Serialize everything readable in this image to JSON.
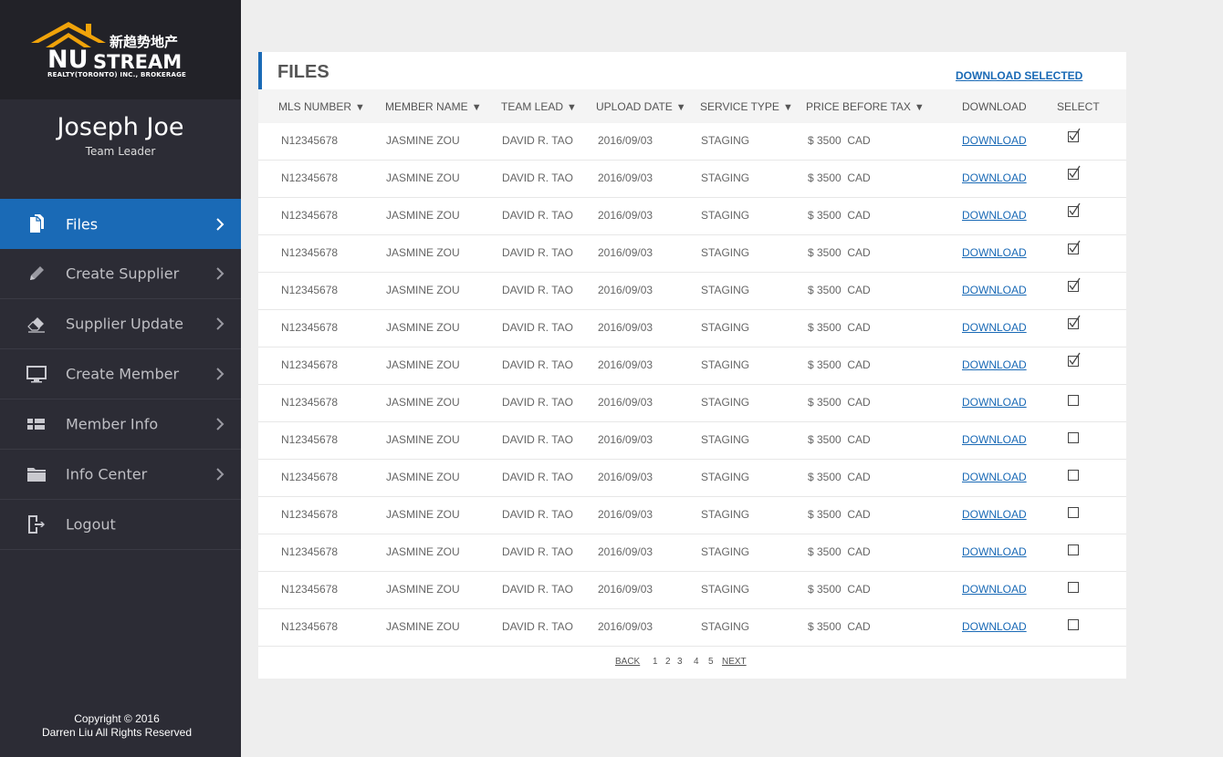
{
  "brand": {
    "logo_main": "NU",
    "logo_stream": "STREAM",
    "logo_cn": "新趋势地产",
    "logo_sub": "REALTY(TORONTO) INC., BROKERAGE",
    "roof_color": "#f0a30a"
  },
  "user": {
    "name": "Joseph Joe",
    "role": "Team Leader"
  },
  "sidebar": {
    "items": [
      {
        "label": "Files",
        "icon": "files-icon",
        "active": true,
        "chevron": true
      },
      {
        "label": "Create Supplier",
        "icon": "pencil-icon",
        "active": false,
        "chevron": true
      },
      {
        "label": "Supplier Update",
        "icon": "eraser-icon",
        "active": false,
        "chevron": true
      },
      {
        "label": "Create Member",
        "icon": "monitor-icon",
        "active": false,
        "chevron": true
      },
      {
        "label": "Member Info",
        "icon": "grid-icon",
        "active": false,
        "chevron": true
      },
      {
        "label": "Info Center",
        "icon": "folder-icon",
        "active": false,
        "chevron": true
      },
      {
        "label": "Logout",
        "icon": "logout-icon",
        "active": false,
        "chevron": false
      }
    ],
    "copyright_line1": "Copyright © 2016",
    "copyright_line2": "Darren Liu All Rights Reserved"
  },
  "files": {
    "title": "FILES",
    "download_selected": "DOWNLOAD SELECTED",
    "columns": [
      {
        "label": "MLS NUMBER",
        "sortable": true
      },
      {
        "label": "MEMBER NAME",
        "sortable": true
      },
      {
        "label": "TEAM LEAD",
        "sortable": true
      },
      {
        "label": "UPLOAD DATE",
        "sortable": true
      },
      {
        "label": "SERVICE TYPE",
        "sortable": true
      },
      {
        "label": "PRICE BEFORE TAX",
        "sortable": true
      },
      {
        "label": "DOWNLOAD",
        "sortable": false
      },
      {
        "label": "SELECT",
        "sortable": false
      }
    ],
    "sort_arrow": "▼",
    "rows": [
      {
        "mls": "N12345678",
        "member": "JASMINE ZOU",
        "lead": "DAVID R. TAO",
        "date": "2016/09/03",
        "service": "STAGING",
        "price": "$ 3500  CAD",
        "download": "DOWNLOAD",
        "selected": true
      },
      {
        "mls": "N12345678",
        "member": "JASMINE ZOU",
        "lead": "DAVID R. TAO",
        "date": "2016/09/03",
        "service": "STAGING",
        "price": "$ 3500  CAD",
        "download": "DOWNLOAD",
        "selected": true
      },
      {
        "mls": "N12345678",
        "member": "JASMINE ZOU",
        "lead": "DAVID R. TAO",
        "date": "2016/09/03",
        "service": "STAGING",
        "price": "$ 3500  CAD",
        "download": "DOWNLOAD",
        "selected": true
      },
      {
        "mls": "N12345678",
        "member": "JASMINE ZOU",
        "lead": "DAVID R. TAO",
        "date": "2016/09/03",
        "service": "STAGING",
        "price": "$ 3500  CAD",
        "download": "DOWNLOAD",
        "selected": true
      },
      {
        "mls": "N12345678",
        "member": "JASMINE ZOU",
        "lead": "DAVID R. TAO",
        "date": "2016/09/03",
        "service": "STAGING",
        "price": "$ 3500  CAD",
        "download": "DOWNLOAD",
        "selected": true
      },
      {
        "mls": "N12345678",
        "member": "JASMINE ZOU",
        "lead": "DAVID R. TAO",
        "date": "2016/09/03",
        "service": "STAGING",
        "price": "$ 3500  CAD",
        "download": "DOWNLOAD",
        "selected": true
      },
      {
        "mls": "N12345678",
        "member": "JASMINE ZOU",
        "lead": "DAVID R. TAO",
        "date": "2016/09/03",
        "service": "STAGING",
        "price": "$ 3500  CAD",
        "download": "DOWNLOAD",
        "selected": true
      },
      {
        "mls": "N12345678",
        "member": "JASMINE ZOU",
        "lead": "DAVID R. TAO",
        "date": "2016/09/03",
        "service": "STAGING",
        "price": "$ 3500  CAD",
        "download": "DOWNLOAD",
        "selected": false
      },
      {
        "mls": "N12345678",
        "member": "JASMINE ZOU",
        "lead": "DAVID R. TAO",
        "date": "2016/09/03",
        "service": "STAGING",
        "price": "$ 3500  CAD",
        "download": "DOWNLOAD",
        "selected": false
      },
      {
        "mls": "N12345678",
        "member": "JASMINE ZOU",
        "lead": "DAVID R. TAO",
        "date": "2016/09/03",
        "service": "STAGING",
        "price": "$ 3500  CAD",
        "download": "DOWNLOAD",
        "selected": false
      },
      {
        "mls": "N12345678",
        "member": "JASMINE ZOU",
        "lead": "DAVID R. TAO",
        "date": "2016/09/03",
        "service": "STAGING",
        "price": "$ 3500  CAD",
        "download": "DOWNLOAD",
        "selected": false
      },
      {
        "mls": "N12345678",
        "member": "JASMINE ZOU",
        "lead": "DAVID R. TAO",
        "date": "2016/09/03",
        "service": "STAGING",
        "price": "$ 3500  CAD",
        "download": "DOWNLOAD",
        "selected": false
      },
      {
        "mls": "N12345678",
        "member": "JASMINE ZOU",
        "lead": "DAVID R. TAO",
        "date": "2016/09/03",
        "service": "STAGING",
        "price": "$ 3500  CAD",
        "download": "DOWNLOAD",
        "selected": false
      },
      {
        "mls": "N12345678",
        "member": "JASMINE ZOU",
        "lead": "DAVID R. TAO",
        "date": "2016/09/03",
        "service": "STAGING",
        "price": "$ 3500  CAD",
        "download": "DOWNLOAD",
        "selected": false
      }
    ],
    "pagination": {
      "back": "BACK",
      "pages": [
        "1",
        "2",
        "3",
        "4",
        "5"
      ],
      "next": "NEXT"
    }
  },
  "colors": {
    "sidebar_bg": "#2c2c35",
    "accent": "#1a6ab6",
    "panel_bg": "#ffffff",
    "page_bg": "#eeeeee"
  }
}
